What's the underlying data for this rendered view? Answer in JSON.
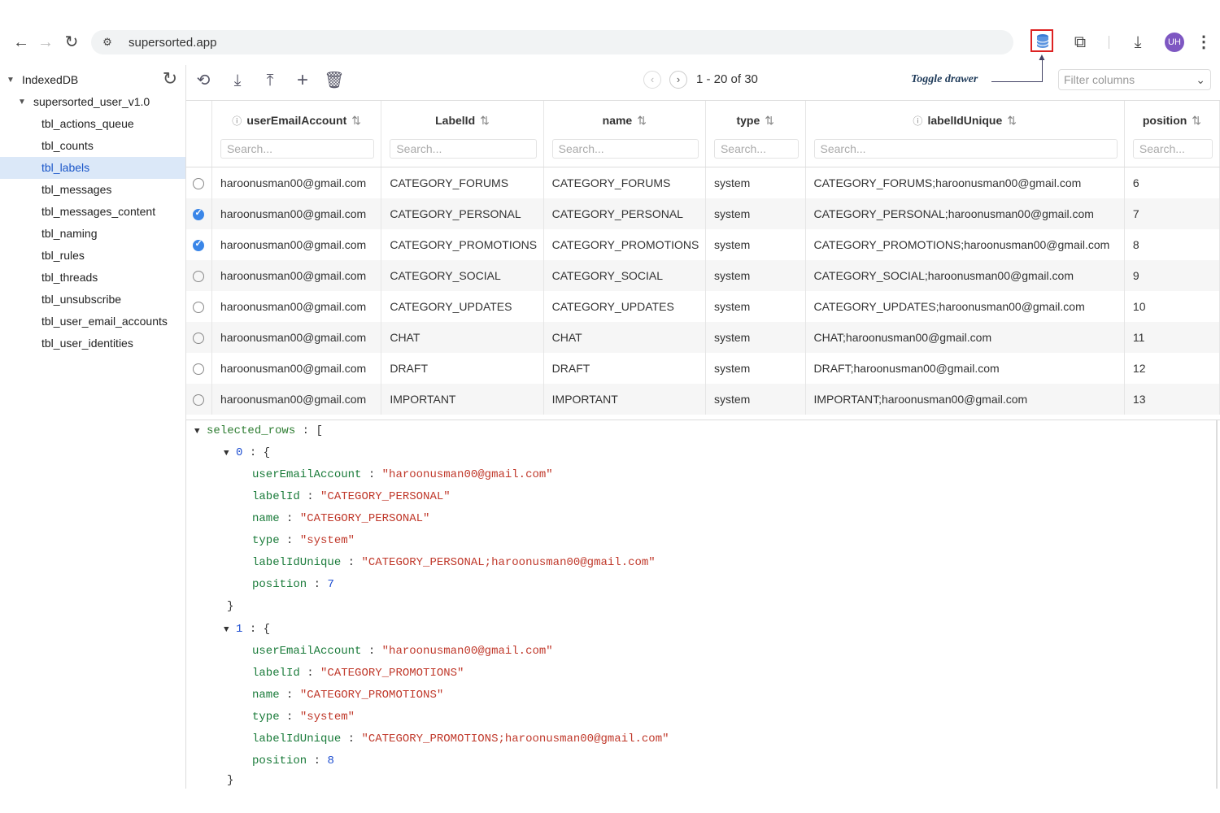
{
  "browser": {
    "url": "supersorted.app",
    "avatar_initials": "UH"
  },
  "sidebar": {
    "db_label": "IndexedDB",
    "database": "supersorted_user_v1.0",
    "tables": [
      "tbl_actions_queue",
      "tbl_counts",
      "tbl_labels",
      "tbl_messages",
      "tbl_messages_content",
      "tbl_naming",
      "tbl_rules",
      "tbl_threads",
      "tbl_unsubscribe",
      "tbl_user_email_accounts",
      "tbl_user_identities"
    ],
    "active_table": "tbl_labels"
  },
  "toolbar": {
    "pager_text": "1 - 20 of 30",
    "toggle_drawer_label": "Toggle drawer",
    "filter_placeholder": "Filter columns"
  },
  "table": {
    "columns": [
      {
        "name": "userEmailAccount",
        "search": "Search..."
      },
      {
        "name": "LabelId",
        "search": "Search..."
      },
      {
        "name": "name",
        "search": "Search..."
      },
      {
        "name": "type",
        "search": "Search..."
      },
      {
        "name": "labelIdUnique",
        "search": "Search..."
      },
      {
        "name": "position",
        "search": "Search..."
      }
    ],
    "rows": [
      {
        "checked": false,
        "email": "haroonusman00@gmail.com",
        "labelId": "CATEGORY_FORUMS",
        "name": "CATEGORY_FORUMS",
        "type": "system",
        "unique": "CATEGORY_FORUMS;haroonusman00@gmail.com",
        "position": "6"
      },
      {
        "checked": true,
        "email": "haroonusman00@gmail.com",
        "labelId": "CATEGORY_PERSONAL",
        "name": "CATEGORY_PERSONAL",
        "type": "system",
        "unique": "CATEGORY_PERSONAL;haroonusman00@gmail.com",
        "position": "7"
      },
      {
        "checked": true,
        "email": "haroonusman00@gmail.com",
        "labelId": "CATEGORY_PROMOTIONS",
        "name": "CATEGORY_PROMOTIONS",
        "type": "system",
        "unique": "CATEGORY_PROMOTIONS;haroonusman00@gmail.com",
        "position": "8"
      },
      {
        "checked": false,
        "email": "haroonusman00@gmail.com",
        "labelId": "CATEGORY_SOCIAL",
        "name": "CATEGORY_SOCIAL",
        "type": "system",
        "unique": "CATEGORY_SOCIAL;haroonusman00@gmail.com",
        "position": "9"
      },
      {
        "checked": false,
        "email": "haroonusman00@gmail.com",
        "labelId": "CATEGORY_UPDATES",
        "name": "CATEGORY_UPDATES",
        "type": "system",
        "unique": "CATEGORY_UPDATES;haroonusman00@gmail.com",
        "position": "10"
      },
      {
        "checked": false,
        "email": "haroonusman00@gmail.com",
        "labelId": "CHAT",
        "name": "CHAT",
        "type": "system",
        "unique": "CHAT;haroonusman00@gmail.com",
        "position": "11"
      },
      {
        "checked": false,
        "email": "haroonusman00@gmail.com",
        "labelId": "DRAFT",
        "name": "DRAFT",
        "type": "system",
        "unique": "DRAFT;haroonusman00@gmail.com",
        "position": "12"
      },
      {
        "checked": false,
        "email": "haroonusman00@gmail.com",
        "labelId": "IMPORTANT",
        "name": "IMPORTANT",
        "type": "system",
        "unique": "IMPORTANT;haroonusman00@gmail.com",
        "position": "13"
      }
    ]
  },
  "json_view": {
    "root_key": "selected_rows",
    "items": [
      {
        "index": "0",
        "userEmailAccount": "\"haroonusman00@gmail.com\"",
        "labelId": "\"CATEGORY_PERSONAL\"",
        "name": "\"CATEGORY_PERSONAL\"",
        "type": "\"system\"",
        "labelIdUnique": "\"CATEGORY_PERSONAL;haroonusman00@gmail.com\"",
        "position": "7"
      },
      {
        "index": "1",
        "userEmailAccount": "\"haroonusman00@gmail.com\"",
        "labelId": "\"CATEGORY_PROMOTIONS\"",
        "name": "\"CATEGORY_PROMOTIONS\"",
        "type": "\"system\"",
        "labelIdUnique": "\"CATEGORY_PROMOTIONS;haroonusman00@gmail.com\"",
        "position": "8"
      }
    ]
  },
  "colors": {
    "accent": "#3a86e8",
    "active_row_bg": "#dbe8f8",
    "highlight_border": "#dd2222",
    "json_key": "#2e7d32",
    "json_string": "#c0392b",
    "json_number": "#1f4fd1"
  }
}
